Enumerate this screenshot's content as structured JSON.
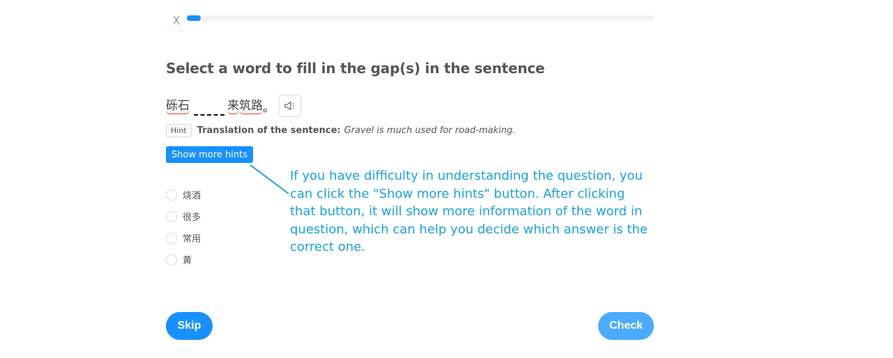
{
  "header": {
    "close_label": "X",
    "progress_percent": 3
  },
  "question": {
    "title": "Select a word to fill in the gap(s) in the sentence",
    "sentence": {
      "word1": "砾石",
      "word2": "来",
      "word3": "筑路",
      "punct": "。"
    },
    "audio_icon": "speaker-icon"
  },
  "hint": {
    "tag": "Hint",
    "label": "Translation of the sentence:",
    "translation": "Gravel is much used for road-making.",
    "more_hints_label": "Show more hints"
  },
  "options": [
    {
      "label": "烧酒"
    },
    {
      "label": "很多"
    },
    {
      "label": "常用"
    },
    {
      "label": "黄"
    }
  ],
  "annotation": {
    "text": "If you have difficulty in understanding the question, you can click the \"Show more hints\" button. After clicking that button, it will show more information of the word in question, which can help you decide which answer is the correct one.",
    "color": "#1aa1e0"
  },
  "footer": {
    "skip_label": "Skip",
    "check_label": "Check"
  },
  "colors": {
    "accent": "#1890ff",
    "check_button": "#4aabff"
  }
}
